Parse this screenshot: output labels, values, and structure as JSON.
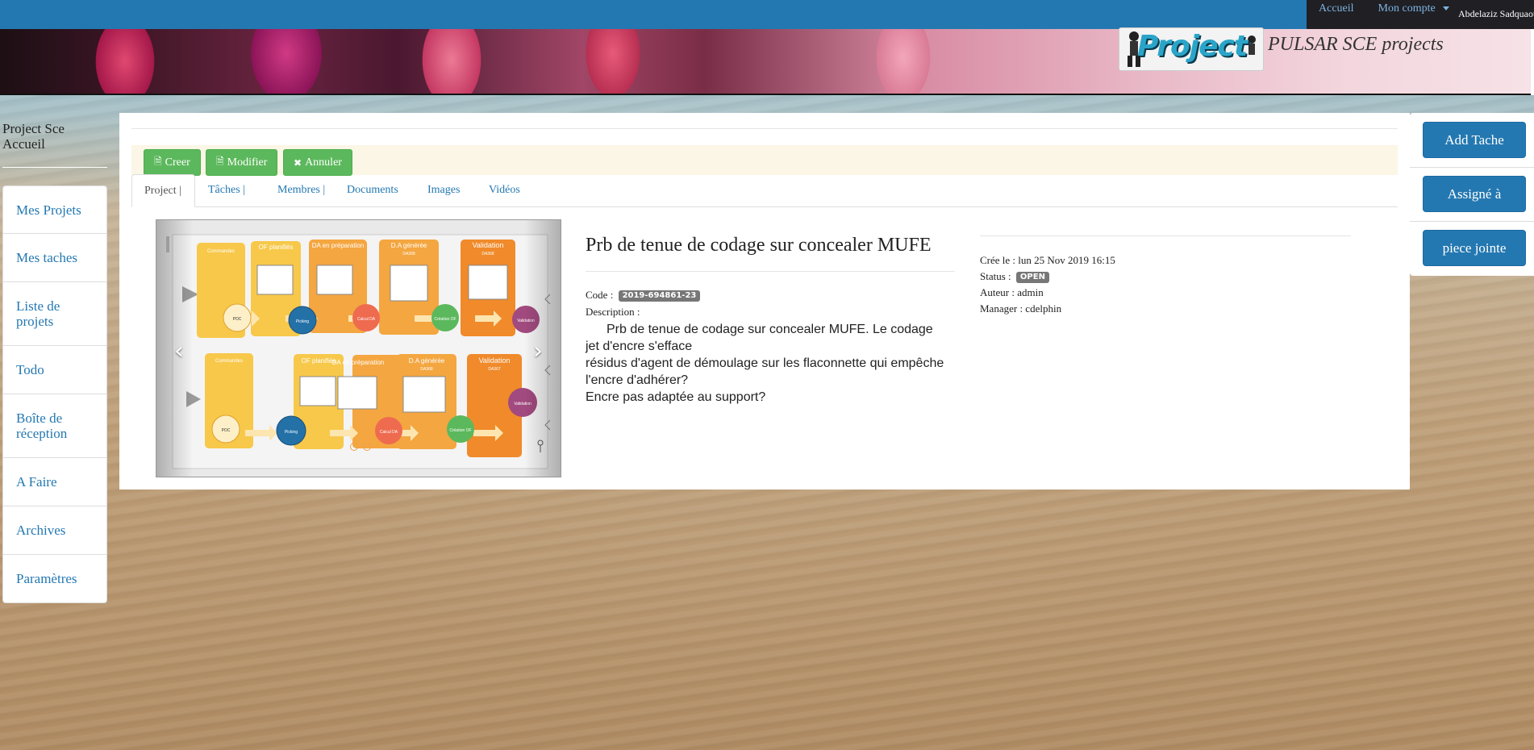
{
  "topnav": {
    "home": "Accueil",
    "account": "Mon compte",
    "user_name": "Abdelaziz Sadquaoui"
  },
  "banner": {
    "logo_text": "Project",
    "brand_title": "PULSAR SCE projects"
  },
  "sidebar": {
    "title_line1": "Project Sce",
    "title_line2": "Accueil",
    "items": [
      {
        "label": "Mes Projets"
      },
      {
        "label": "Mes taches"
      },
      {
        "label": "Liste de projets"
      },
      {
        "label": "Todo"
      },
      {
        "label": "Boîte de réception"
      },
      {
        "label": "A Faire"
      },
      {
        "label": "Archives"
      },
      {
        "label": "Paramètres"
      }
    ]
  },
  "toolbar": {
    "create_label": "Creer",
    "edit_label": "Modifier",
    "cancel_label": "Annuler"
  },
  "tabs": [
    "Project |",
    "Tâches |",
    "Membres |",
    "Documents",
    "Images",
    "Vidéos"
  ],
  "project": {
    "title": "Prb de tenue de codage sur concealer MUFE",
    "code_label": "Code :",
    "code": "2019-694861-23",
    "description_label": "Description :",
    "description": [
      "Prb de tenue de codage sur concealer MUFE. Le codage jet d'encre s'efface",
      "résidus d'agent de démoulage sur les flaconnette qui empêche l'encre d'adhérer?",
      "Encre pas adaptée au support?"
    ]
  },
  "meta": {
    "created": "Crée le : lun 25 Nov 2019 16:15",
    "status_label": "Status :",
    "status": "OPEN",
    "author": "Auteur : admin",
    "manager": "Manager : cdelphin"
  },
  "actions": {
    "add_task": "Add Tache",
    "assigned": "Assigné à",
    "attachment": "piece jointe"
  },
  "carousel": {
    "top_row": [
      {
        "title": "Commandes"
      },
      {
        "title": "OF planifiés"
      },
      {
        "title": "DA en préparation"
      },
      {
        "title": "D.A générée",
        "sub": "DA368"
      },
      {
        "title": "Validation",
        "sub": "DA368"
      }
    ],
    "bottom_row": [
      {
        "title": "Commandes"
      },
      {
        "title": "OF planifiés"
      },
      {
        "title": "DA en préparation"
      },
      {
        "title": "D.A générée",
        "sub": "DA368"
      },
      {
        "title": "Validation",
        "sub": "DA367"
      }
    ],
    "circles": [
      "POC",
      "Picking",
      "Calcul DA",
      "Création OF",
      "Validation"
    ],
    "colors": {
      "yellow": "#f7c84a",
      "orange": "#f4a640",
      "deep_orange": "#f08a2a",
      "blue": "#2471a8",
      "red": "#ee6b50",
      "green": "#5cb85c",
      "purple": "#a14a7f"
    }
  }
}
